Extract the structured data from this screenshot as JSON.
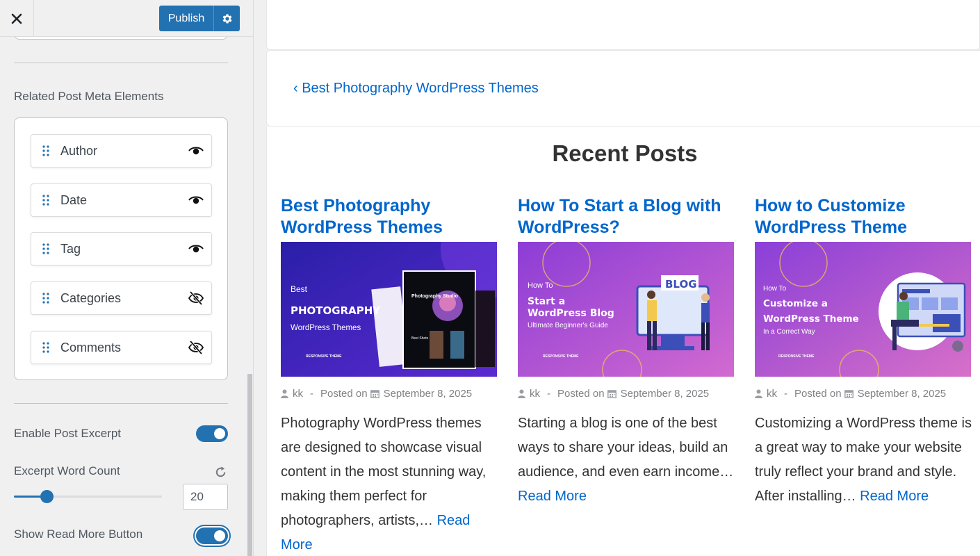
{
  "customizer": {
    "publish_label": "Publish",
    "section_label": "Related Post Meta Elements",
    "meta_items": [
      {
        "label": "Author",
        "visible": true
      },
      {
        "label": "Date",
        "visible": true
      },
      {
        "label": "Tag",
        "visible": true
      },
      {
        "label": "Categories",
        "visible": false
      },
      {
        "label": "Comments",
        "visible": false
      }
    ],
    "excerpt_toggle_label": "Enable Post Excerpt",
    "excerpt_enabled": true,
    "word_count_label": "Excerpt Word Count",
    "word_count_value": "20",
    "word_count_slider_fraction": 0.22,
    "read_more_toggle_label": "Show Read More Button",
    "read_more_enabled": true,
    "accent_color": "#2271b1"
  },
  "preview": {
    "prev_post_link": "‹ Best Photography WordPress Themes",
    "recent_title": "Recent Posts",
    "link_color": "#0066cc",
    "posts": [
      {
        "title": "Best Photography WordPress Themes",
        "author": "kk",
        "sep": "-",
        "posted_on": "Posted on",
        "date": "September 8, 2025",
        "excerpt": "Photography WordPress themes are designed to showcase visual content in the most stunning way, making them perfect for photographers, artists,… ",
        "read_more": "Read More",
        "thumb": {
          "line1": "Best",
          "line2": "PHOTOGRAPHY",
          "line3": "WordPress Themes",
          "brand": "RESPONSIVE THEME",
          "mock1": "Photography Studio",
          "mock2": "Best Shots"
        }
      },
      {
        "title": "How To Start a Blog with WordPress?",
        "author": "kk",
        "sep": "-",
        "posted_on": "Posted on",
        "date": "September 8, 2025",
        "excerpt": "Starting a blog is one of the best ways to share your ideas, build an audience, and even earn income… ",
        "read_more": "Read More",
        "thumb": {
          "line1": "How To",
          "line2": "Start a",
          "line3": "WordPress Blog",
          "line4": "Ultimate Beginner's Guide",
          "badge": "BLOG",
          "brand": "RESPONSIVE THEME"
        }
      },
      {
        "title": "How to Customize WordPress Theme",
        "author": "kk",
        "sep": "-",
        "posted_on": "Posted on",
        "date": "September 8, 2025",
        "excerpt": "Customizing a WordPress theme is a great way to make your website truly reflect your brand and style. After installing… ",
        "read_more": "Read More",
        "thumb": {
          "line1": "How To",
          "line2": "Customize a",
          "line3": "WordPress Theme",
          "line4": "In a Correct Way",
          "brand": "RESPONSIVE THEME"
        }
      }
    ]
  }
}
